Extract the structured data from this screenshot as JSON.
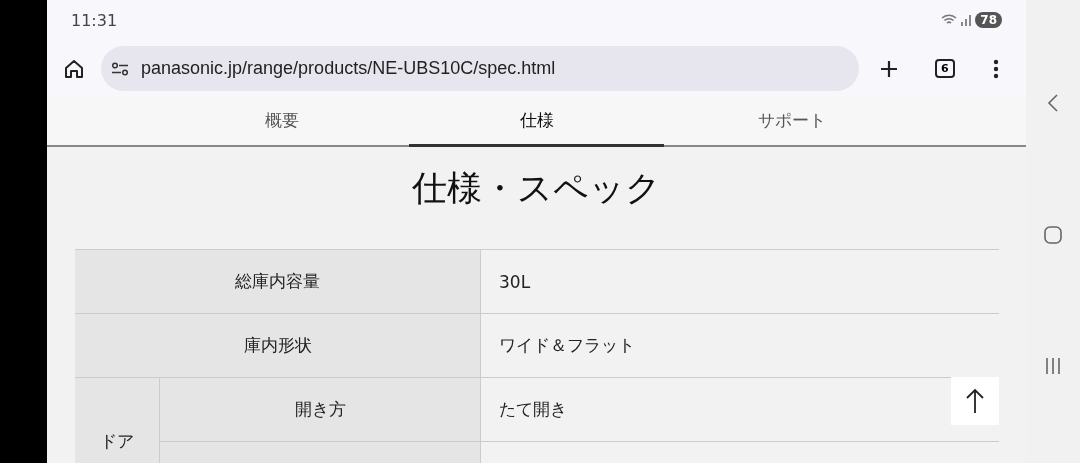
{
  "status_bar": {
    "time": "11:31",
    "battery": "78"
  },
  "browser": {
    "url": "panasonic.jp/range/products/NE-UBS10C/spec.html",
    "tab_count": "6"
  },
  "tabs": [
    {
      "label": "概要",
      "selected": false
    },
    {
      "label": "仕様",
      "selected": true
    },
    {
      "label": "サポート",
      "selected": false
    }
  ],
  "heading": "仕様・スペック",
  "spec_table": [
    {
      "kind": "row",
      "label": "総庫内容量",
      "value": "30L"
    },
    {
      "kind": "row",
      "label": "庫内形状",
      "value": "ワイド＆フラット"
    },
    {
      "kind": "group",
      "label": "ドア",
      "rows": [
        {
          "label": "開き方",
          "value": "たて開き"
        },
        {
          "label": "",
          "value": ""
        }
      ]
    }
  ]
}
